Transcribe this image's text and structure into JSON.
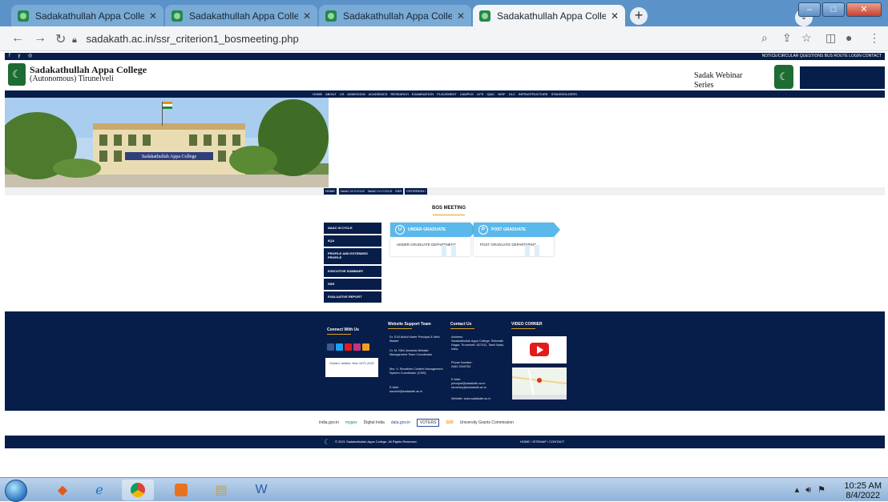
{
  "browser": {
    "tabs": [
      {
        "title": "Sadakathullah Appa College, Pala"
      },
      {
        "title": "Sadakathullah Appa College, Pala"
      },
      {
        "title": "Sadakathullah Appa College, Pala"
      },
      {
        "title": "Sadakathullah Appa College, Pala"
      }
    ],
    "new_tab": "+",
    "url": "sadakath.ac.in/ssr_criterion1_bosmeeting.php"
  },
  "site": {
    "social": "f y ◎",
    "top_links": "NOTICE/CIRCULAR   QUESTIONS   BUS ROUTE   LOGIN   CONTACT",
    "college_name": "Sadakathullah Appa College",
    "college_sub": "(Autonomous) Tirunelveli",
    "webinar": "Sadak Webinar Series",
    "menu": "HOME  ABOUT US  ADMISSION  ACADEMICS  RESEARCH  EXAMINATION  PLACEMENT  CAMPUS LIFE  IQAC  NIRF  DLC  INFRASTRUCTURE  STAKEHOLDERS",
    "hero_sign": "Sadakathullah Appa College",
    "breadcrumbs": [
      "HOME",
      "NAAC III CYCLE",
      "NAAC IV CYCLE",
      "SSR",
      "CRITERION I"
    ],
    "page_title": "BOS MEETING",
    "side_menu": [
      "NAAC III CYCLE",
      "IIQA",
      "PROFILE AND EXTENDED PROFILE",
      "EXECUTIVE SUMMARY",
      "SSR",
      "EVALUATIVE REPORT"
    ],
    "cards": [
      {
        "icon": "U",
        "head": "UNDER GRADUATE",
        "body": "UNDER GRADUATE DEPARTMENT"
      },
      {
        "icon": "P",
        "head": "POST GRADUATE",
        "body": "POST GRADUATE DEPARTMENT"
      }
    ],
    "footer": {
      "connect": "Connect With Us",
      "jubilee": "Golden Jubilee Year 1971-2021",
      "support_title": "Website Support Team",
      "support_1": "Dr. S.M.Abdul Kader Principal & Web Master",
      "support_2": "Dr. M. Sithi Jameela Website Management Team Coordinator",
      "support_3": "Mrs. V. Revathee Content Management System Coordinator (CMS)",
      "support_mail_label": "E-Mail:",
      "support_mail": "sacweb@sadakath.ac.in",
      "contact_title": "Contact Us",
      "address_label": "Address:",
      "address": "Sadakathullah Appa College, Rahmath Nagar, Tirunelveli -627011, Tamil Nadu, India.",
      "phone_label": "Phone Number:",
      "phone": "0462 2540763",
      "email_label": "E-Mail:",
      "email": "principal@sadakath.ac.in secretary@sadakath.ac.in",
      "website": "Website: www.sadakath.ac.in",
      "video_title": "VIDEO CORNER"
    },
    "partners": [
      "india.gov.in",
      "mygov",
      "Digital India",
      "data.gov.in",
      "VOTERS",
      "GOI",
      "University Grants Commission"
    ],
    "copyright": "© 2021 Sadakathullah Appa College. All Rights Reserved.",
    "bottom_links": "HOME  /  SITEMAP  /  CONTACT"
  },
  "taskbar": {
    "time": "10:25 AM",
    "date": "8/4/2022"
  }
}
